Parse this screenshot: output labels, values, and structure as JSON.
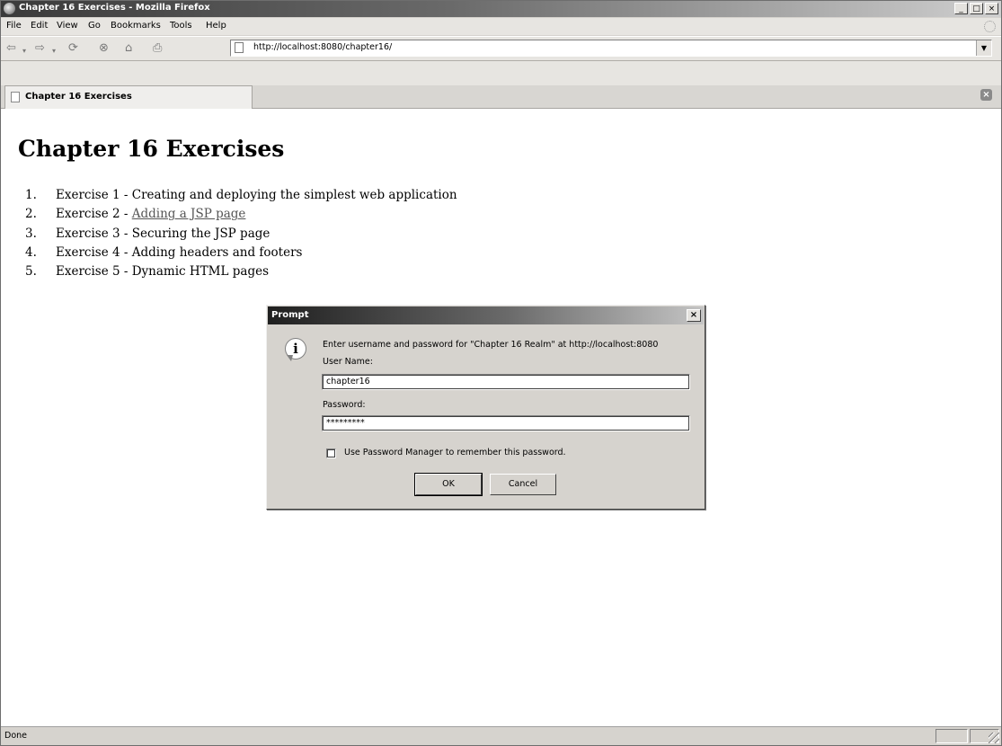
{
  "window": {
    "title": "Chapter 16 Exercises - Mozilla Firefox",
    "minimize": "_",
    "maximize": "□",
    "close": "×"
  },
  "menu": [
    {
      "label": "File"
    },
    {
      "label": "Edit"
    },
    {
      "label": "View"
    },
    {
      "label": "Go"
    },
    {
      "label": "Bookmarks"
    },
    {
      "label": "Tools"
    },
    {
      "label": "Help"
    }
  ],
  "toolbar": {
    "icons": [
      "back-arrow-icon",
      "dropdown-icon",
      "forward-arrow-icon",
      "dropdown-icon",
      "reload-icon",
      "stop-icon",
      "home-icon",
      "print-icon"
    ],
    "url": "http://localhost:8080/chapter16/"
  },
  "tab": {
    "label": "Chapter 16 Exercises",
    "close": "×"
  },
  "page": {
    "title": "Chapter 16 Exercises",
    "items": [
      {
        "num": "1.",
        "prefix": "Exercise 1 - ",
        "text": "Creating and deploying the simplest web application",
        "link": false
      },
      {
        "num": "2.",
        "prefix": "Exercise 2 - ",
        "text": "Adding a JSP page",
        "link": true
      },
      {
        "num": "3.",
        "prefix": "Exercise 3 - ",
        "text": "Securing the JSP page",
        "link": false
      },
      {
        "num": "4.",
        "prefix": "Exercise 4 - ",
        "text": "Adding headers and footers",
        "link": false
      },
      {
        "num": "5.",
        "prefix": "Exercise 5 - ",
        "text": "Dynamic HTML pages",
        "link": false
      }
    ]
  },
  "dialog": {
    "title": "Prompt",
    "close": "×",
    "icon": "i",
    "message": "Enter username and password for \"Chapter 16 Realm\" at http://localhost:8080",
    "username_label": "User Name:",
    "username_value": "chapter16",
    "password_label": "Password:",
    "password_value": "*********",
    "remember_label": "Use Password Manager to remember this password.",
    "remember_checked": false,
    "ok_label": "OK",
    "cancel_label": "Cancel"
  },
  "status": {
    "text": "Done"
  },
  "colors": {
    "titlebar_dark": "#3a3a3a",
    "chrome": "#d6d3ce",
    "link": "#555555"
  }
}
